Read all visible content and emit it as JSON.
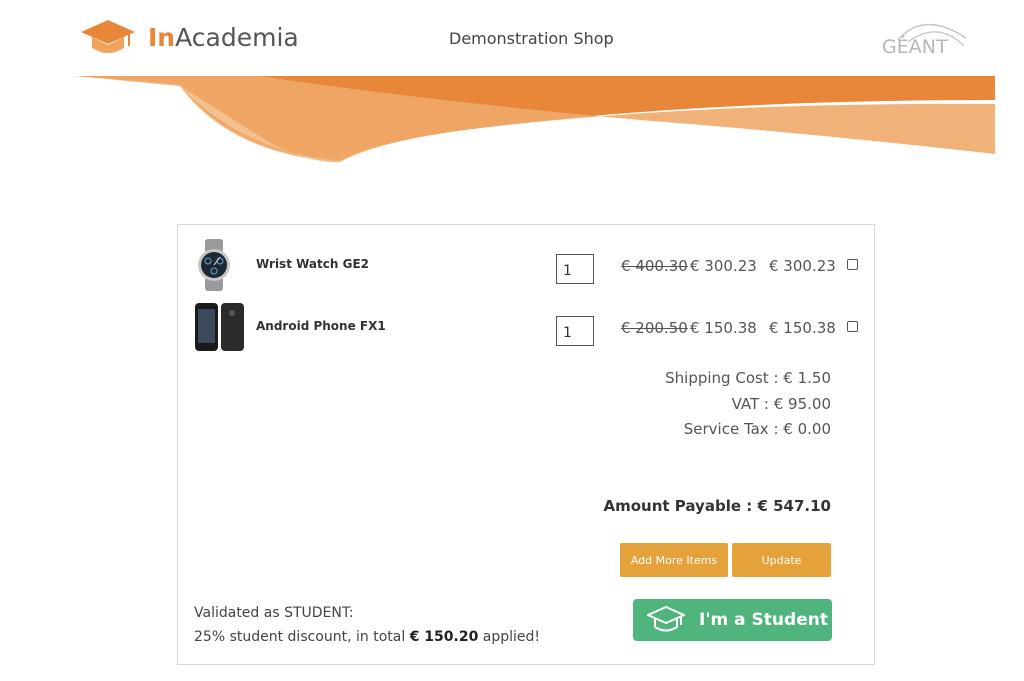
{
  "header": {
    "logo_prefix": "In",
    "logo_suffix": "Academia",
    "shop_title": "Demonstration Shop",
    "partner_logo": "GÉANT"
  },
  "items": [
    {
      "name": "Wrist Watch GE2",
      "quantity": "1",
      "old_price": "€ 400.30",
      "new_price": "€ 300.23",
      "total": "€ 300.23",
      "icon": "wrist-watch-image"
    },
    {
      "name": "Android Phone FX1",
      "quantity": "1",
      "old_price": "€ 200.50",
      "new_price": "€ 150.38",
      "total": "€ 150.38",
      "icon": "android-phone-image"
    }
  ],
  "summary": {
    "shipping": "Shipping Cost : € 1.50",
    "vat": "VAT : € 95.00",
    "service_tax": "Service Tax : € 0.00",
    "amount_payable": "Amount Payable : € 547.10"
  },
  "buttons": {
    "add_more": "Add More Items",
    "update": "Update",
    "student": "I'm a Student"
  },
  "validation": {
    "line1": "Validated as STUDENT:",
    "line2_prefix": "25% student discount, in total ",
    "line2_amount": "€ 150.20",
    "line2_suffix": " applied!"
  },
  "colors": {
    "brand_orange": "#e8873a",
    "button_orange": "#e6a23a",
    "student_green": "#4fb57c"
  }
}
